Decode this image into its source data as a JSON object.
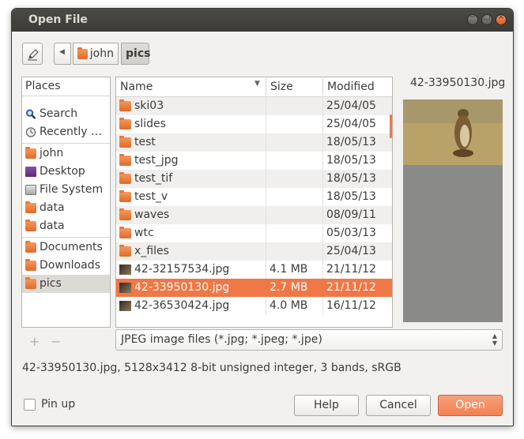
{
  "window": {
    "title": "Open File"
  },
  "toolbar": {
    "crumbs": [
      "john",
      "pics"
    ]
  },
  "places": {
    "header": "Places",
    "items": [
      {
        "label": "Search",
        "icon": "search-icon"
      },
      {
        "label": "Recently …",
        "icon": "recent-icon"
      },
      {
        "label": "john",
        "icon": "home-folder-icon"
      },
      {
        "label": "Desktop",
        "icon": "desktop-icon"
      },
      {
        "label": "File System",
        "icon": "drive-icon"
      },
      {
        "label": "data",
        "icon": "folder-icon"
      },
      {
        "label": "data",
        "icon": "folder-icon"
      },
      {
        "label": "Documents",
        "icon": "folder-icon"
      },
      {
        "label": "Downloads",
        "icon": "folder-icon"
      },
      {
        "label": "pics",
        "icon": "folder-icon",
        "selected": true
      }
    ],
    "add_label": "+",
    "remove_label": "−"
  },
  "files": {
    "columns": {
      "name": "Name",
      "size": "Size",
      "modified": "Modified"
    },
    "rows": [
      {
        "name": "ski03",
        "size": "",
        "modified": "25/04/05",
        "type": "folder"
      },
      {
        "name": "slides",
        "size": "",
        "modified": "25/04/05",
        "type": "folder"
      },
      {
        "name": "test",
        "size": "",
        "modified": "18/05/13",
        "type": "folder"
      },
      {
        "name": "test_jpg",
        "size": "",
        "modified": "18/05/13",
        "type": "folder"
      },
      {
        "name": "test_tif",
        "size": "",
        "modified": "18/05/13",
        "type": "folder"
      },
      {
        "name": "test_v",
        "size": "",
        "modified": "18/05/13",
        "type": "folder"
      },
      {
        "name": "waves",
        "size": "",
        "modified": "08/09/11",
        "type": "folder"
      },
      {
        "name": "wtc",
        "size": "",
        "modified": "05/03/13",
        "type": "folder"
      },
      {
        "name": "x_files",
        "size": "",
        "modified": "25/04/13",
        "type": "folder"
      },
      {
        "name": "42-32157534.jpg",
        "size": "4.1 MB",
        "modified": "21/11/12",
        "type": "image"
      },
      {
        "name": "42-33950130.jpg",
        "size": "2.7 MB",
        "modified": "21/11/12",
        "type": "image",
        "selected": true
      },
      {
        "name": "42-36530424.jpg",
        "size": "4.0 MB",
        "modified": "16/11/12",
        "type": "image"
      }
    ]
  },
  "preview": {
    "filename": "42-33950130.jpg"
  },
  "filter": {
    "value": "JPEG image files (*.jpg; *.jpeg; *.jpe)"
  },
  "info": {
    "text": "42-33950130.jpg, 5128x3412 8-bit unsigned integer, 3 bands, sRGB"
  },
  "pin": {
    "label": "Pin up",
    "checked": false
  },
  "buttons": {
    "help": "Help",
    "cancel": "Cancel",
    "open": "Open"
  },
  "colors": {
    "accent": "#f07746",
    "titlebar": "#3c3b37",
    "window_bg": "#f2f1f0"
  }
}
